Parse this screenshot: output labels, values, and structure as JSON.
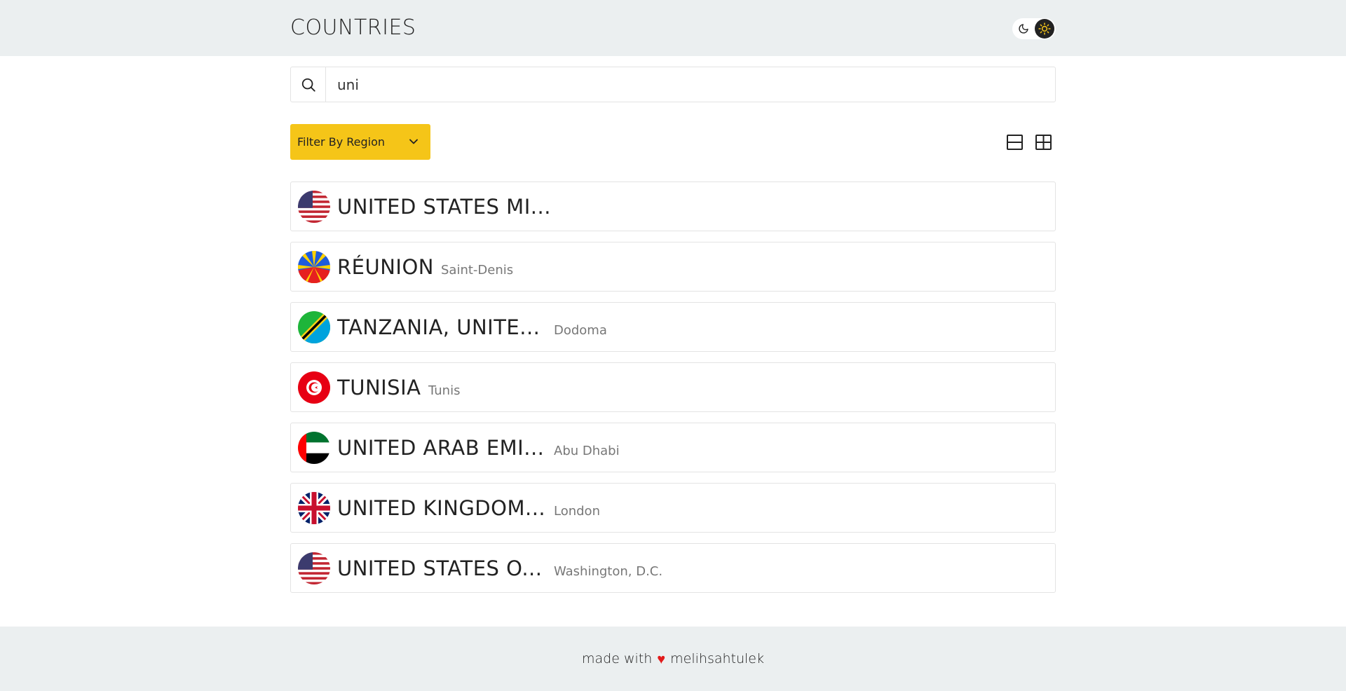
{
  "header": {
    "title": "COUNTRIES",
    "theme": {
      "dark_icon": "moon-icon",
      "light_icon": "sun-icon",
      "active": "light",
      "active_color": "#f5c518"
    }
  },
  "search": {
    "value": "uni",
    "placeholder": "",
    "icon": "search-icon"
  },
  "filter": {
    "label": "Filter By Region",
    "color": "#f5c518"
  },
  "view_toggle": {
    "list_icon": "list-view-icon",
    "grid_icon": "grid-view-icon"
  },
  "countries": [
    {
      "name": "UNITED STATES MI...",
      "capital": "",
      "flag": "us"
    },
    {
      "name": "RÉUNION",
      "capital": "Saint-Denis",
      "flag": "re"
    },
    {
      "name": "TANZANIA, UNITE...",
      "capital": "Dodoma",
      "flag": "tz"
    },
    {
      "name": "TUNISIA",
      "capital": "Tunis",
      "flag": "tn"
    },
    {
      "name": "UNITED ARAB EMI...",
      "capital": "Abu Dhabi",
      "flag": "ae"
    },
    {
      "name": "UNITED KINGDOM...",
      "capital": "London",
      "flag": "gb"
    },
    {
      "name": "UNITED STATES O...",
      "capital": "Washington, D.C.",
      "flag": "us"
    }
  ],
  "footer": {
    "prefix": "made with",
    "heart": "♥",
    "author": "melihsahtulek"
  }
}
